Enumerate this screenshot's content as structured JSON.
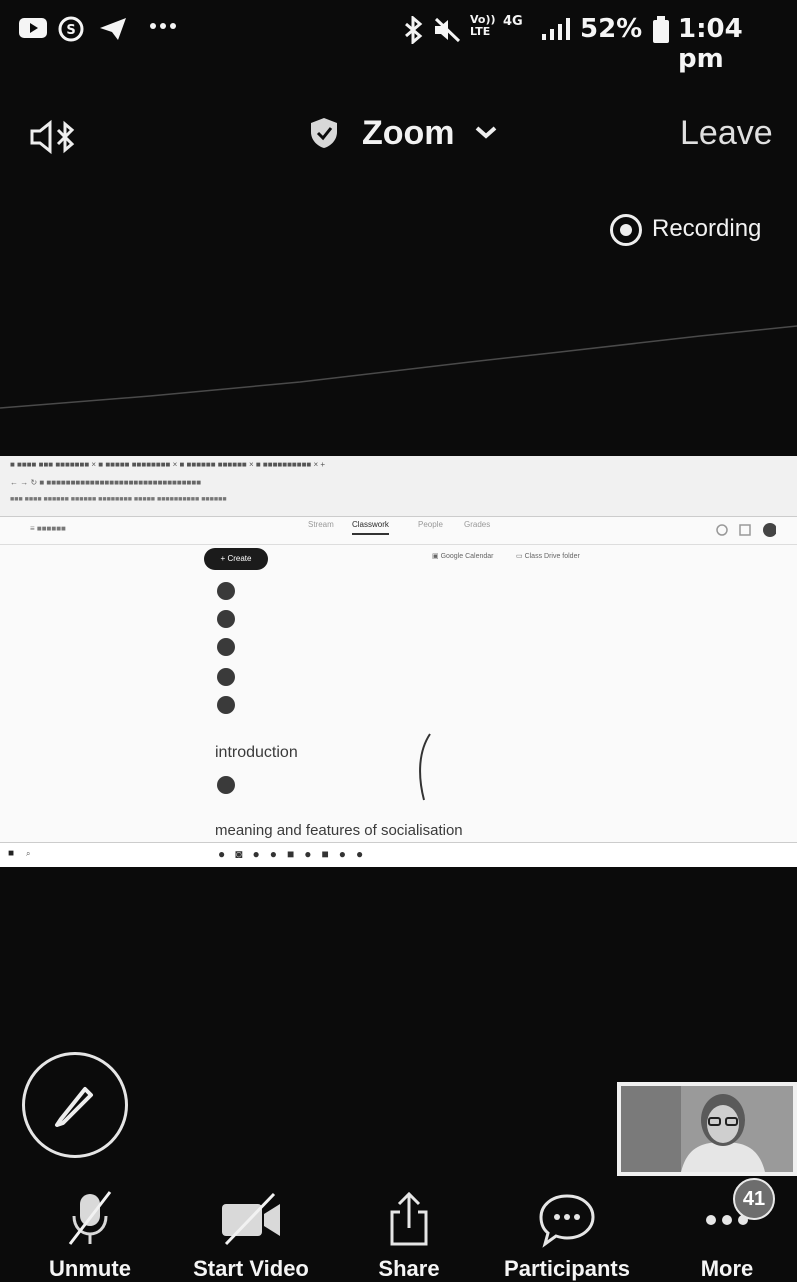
{
  "status_bar": {
    "signal_text": "Vo)) LTE",
    "network": "4G",
    "battery": "52%",
    "time": "1:04 pm",
    "icons": [
      "youtube-icon",
      "skype-icon",
      "telegram-icon",
      "more-dots-icon",
      "bluetooth-icon",
      "mute-icon",
      "signal-icon",
      "battery-icon"
    ]
  },
  "meeting_header": {
    "title": "Zoom",
    "leave_label": "Leave",
    "recording_label": "Recording"
  },
  "shared_screen": {
    "create_label": "Create",
    "calendar_link": "Google Calendar",
    "drive_link": "Class Drive folder",
    "tabs": [
      "Stream",
      "Classwork",
      "People",
      "Grades"
    ],
    "active_tab": "Classwork",
    "items_top": [
      "",
      "",
      "",
      "",
      ""
    ],
    "topic_1": "introduction",
    "topic_1_item": "",
    "topic_2": "meaning and features of socialisation",
    "taskbar_search": "",
    "taskbar_time": ""
  },
  "toolbar": {
    "unmute_label": "Unmute",
    "start_video_label": "Start Video",
    "share_label": "Share",
    "participants_label": "Participants",
    "more_label": "More",
    "participants_count": "41"
  }
}
